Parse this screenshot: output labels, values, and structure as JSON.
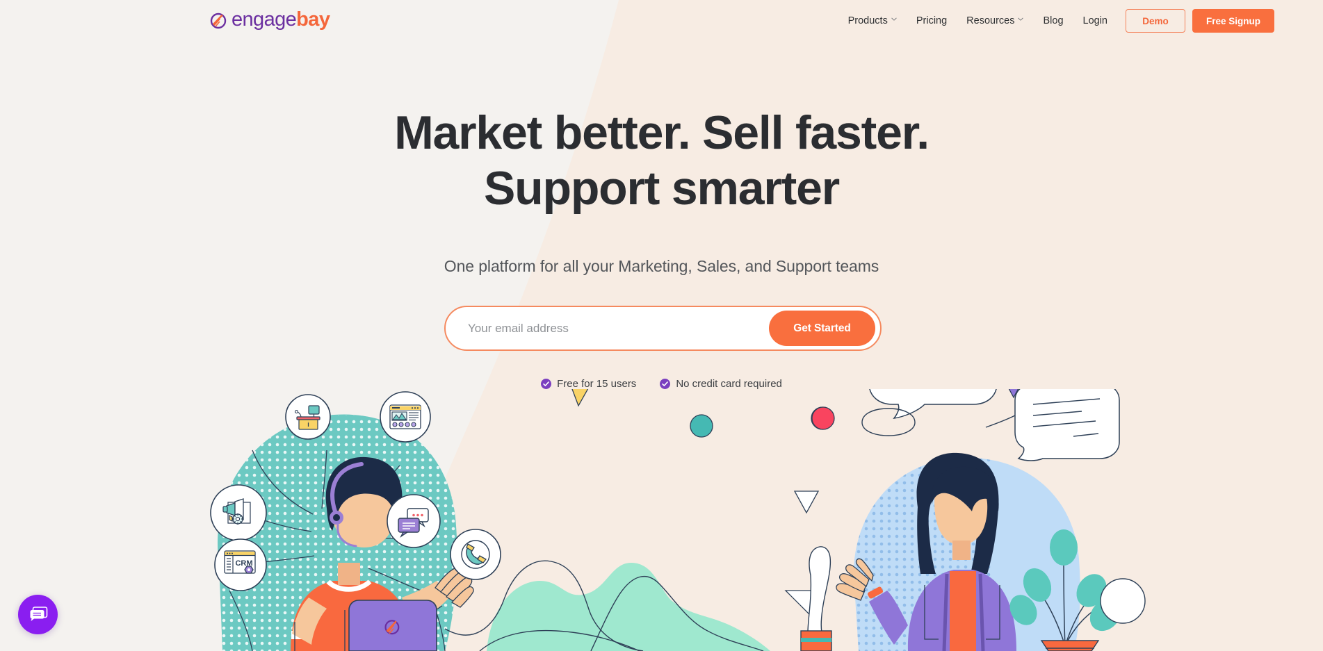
{
  "brand": {
    "name_part1": "engage",
    "name_part2": "bay",
    "logo_icon": "engagebay-swoosh-logo",
    "purple": "#6b2fa0",
    "orange": "#f4663a"
  },
  "nav": {
    "links": [
      {
        "label": "Products",
        "has_caret": true
      },
      {
        "label": "Pricing",
        "has_caret": false
      },
      {
        "label": "Resources",
        "has_caret": true
      },
      {
        "label": "Blog",
        "has_caret": false
      },
      {
        "label": "Login",
        "has_caret": false
      }
    ],
    "demo_label": "Demo",
    "signup_label": "Free Signup"
  },
  "hero": {
    "title_line1": "Market better. Sell faster.",
    "title_line2": "Support smarter",
    "subtitle": "One platform for all your Marketing, Sales, and Support teams",
    "email_placeholder": "Your email address",
    "email_value": "",
    "cta_label": "Get Started",
    "badges": [
      {
        "icon": "check-circle-icon",
        "label": "Free for 15 users"
      },
      {
        "icon": "check-circle-icon",
        "label": "No credit card required"
      }
    ]
  },
  "illustration": {
    "left_scene": "support-agent-with-headset-and-laptop",
    "right_scene": "woman-with-speech-bubbles-and-plant",
    "feature_bubbles": [
      "helpdesk-icon",
      "dashboard-analytics-icon",
      "megaphone-marketing-automation-icon",
      "live-chat-icon",
      "telephony-phone-icon",
      "crm-icon"
    ],
    "crm_label": "CRM",
    "helpdesk_label": "i"
  },
  "chat_widget": {
    "icon": "chat-bubble-icon",
    "color": "#8a1ef0"
  },
  "theme": {
    "bg_left": "#f4f2ef",
    "bg_right": "#f7ece3",
    "orange": "#f96f3e",
    "purple": "#8a1ef0",
    "teal": "#6cc9c2",
    "ink": "#2b2d31"
  }
}
